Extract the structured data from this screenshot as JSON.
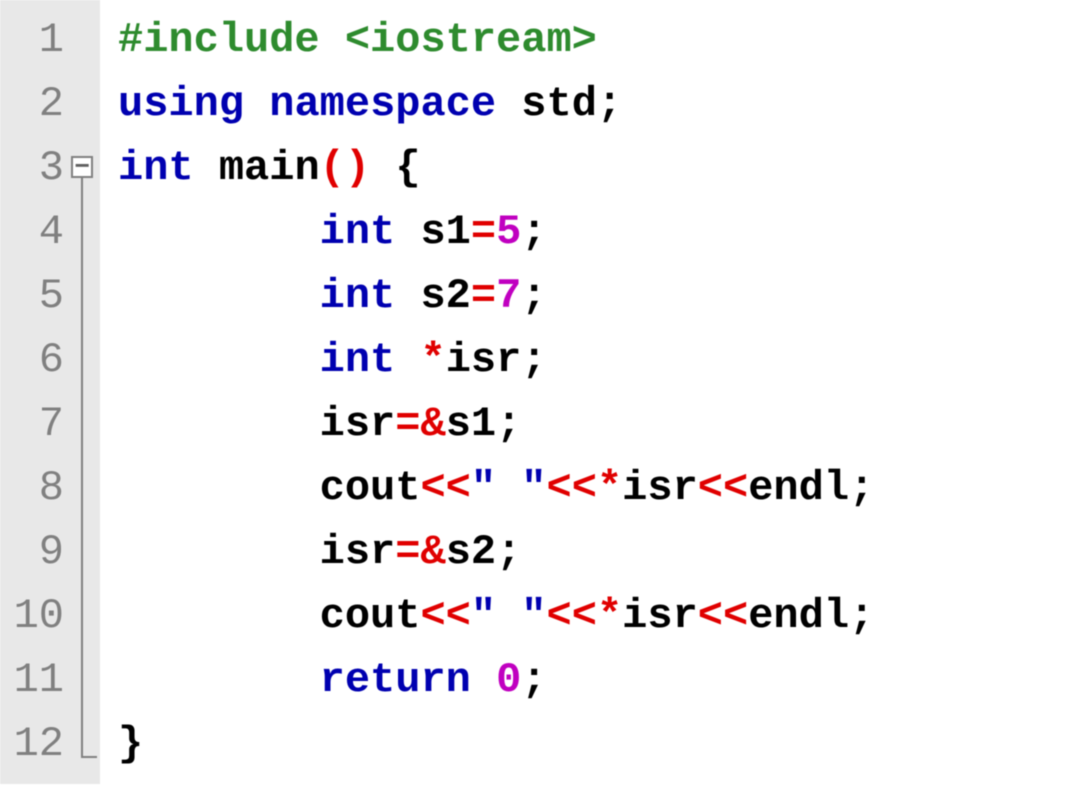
{
  "editor": {
    "line_numbers": [
      "1",
      "2",
      "3",
      "4",
      "5",
      "6",
      "7",
      "8",
      "9",
      "10",
      "11",
      "12"
    ],
    "fold": {
      "minus": "−"
    }
  },
  "code": {
    "l1": {
      "pp": "#include <iostream>"
    },
    "l2": {
      "kw1": "using",
      "kw2": "namespace",
      "id": " std",
      "sc": ";"
    },
    "l3": {
      "type": "int",
      "fn": " main",
      "lp": "(",
      "rp": ")",
      "sp": " ",
      "lb": "{"
    },
    "l4": {
      "indent": "        ",
      "type": "int",
      "id": " s1",
      "eq": "=",
      "num": "5",
      "sc": ";"
    },
    "l5": {
      "indent": "        ",
      "type": "int",
      "id": " s2",
      "eq": "=",
      "num": "7",
      "sc": ";"
    },
    "l6": {
      "indent": "        ",
      "type": "int",
      "sp": " ",
      "star": "*",
      "id": "isr",
      "sc": ";"
    },
    "l7": {
      "indent": "        ",
      "id1": "isr",
      "eq": "=",
      "amp": "&",
      "id2": "s1",
      "sc": ";"
    },
    "l8": {
      "indent": "        ",
      "id1": "cout",
      "op1": "<<",
      "str": "\" \"",
      "op2": "<<",
      "star": "*",
      "id2": "isr",
      "op3": "<<",
      "id3": "endl",
      "sc": ";"
    },
    "l9": {
      "indent": "        ",
      "id1": "isr",
      "eq": "=",
      "amp": "&",
      "id2": "s2",
      "sc": ";"
    },
    "l10": {
      "indent": "        ",
      "id1": "cout",
      "op1": "<<",
      "str": "\" \"",
      "op2": "<<",
      "star": "*",
      "id2": "isr",
      "op3": "<<",
      "id3": "endl",
      "sc": ";"
    },
    "l11": {
      "indent": "        ",
      "kw": "return",
      "sp": " ",
      "num": "0",
      "sc": ";"
    },
    "l12": {
      "rb": "}"
    }
  }
}
